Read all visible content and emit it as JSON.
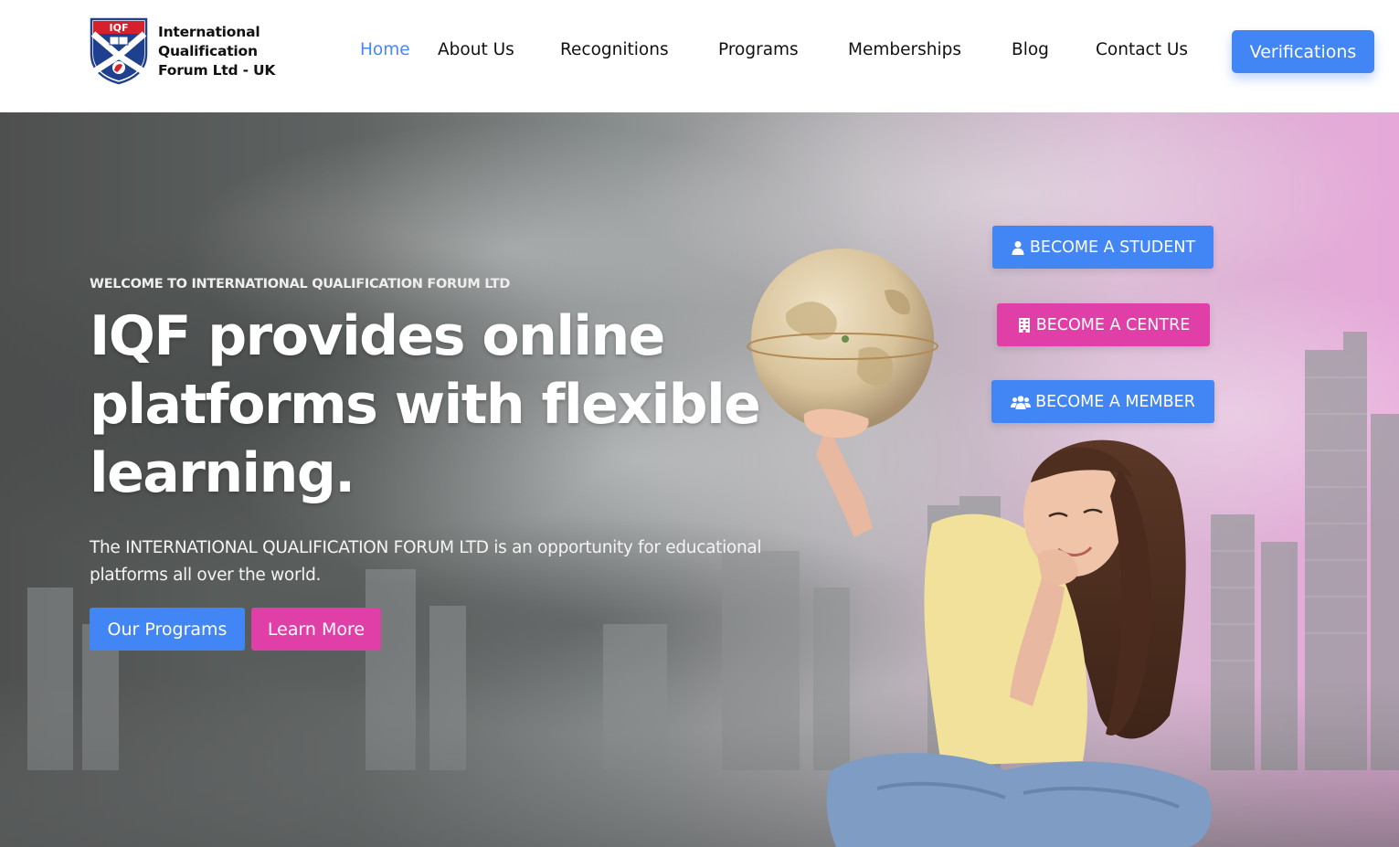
{
  "header": {
    "logo": {
      "shield_text": "IQF",
      "name_line1": "International",
      "name_line2": "Qualification",
      "name_line3": "Forum Ltd - UK"
    },
    "nav": [
      {
        "label": "Home",
        "active": true
      },
      {
        "label": "About Us",
        "active": false
      },
      {
        "label": "Recognitions",
        "active": false
      },
      {
        "label": "Programs",
        "active": false
      },
      {
        "label": "Memberships",
        "active": false
      },
      {
        "label": "Blog",
        "active": false
      },
      {
        "label": "Contact Us",
        "active": false
      }
    ],
    "verify_label": "Verifications"
  },
  "hero": {
    "welcome": "WELCOME TO INTERNATIONAL QUALIFICATION FORUM LTD",
    "headline": "IQF provides online platforms with flexible learning.",
    "description": "The INTERNATIONAL QUALIFICATION FORUM LTD is an opportunity for educational platforms all over the world.",
    "buttons": {
      "programs": "Our Programs",
      "learn_more": "Learn More"
    },
    "cta": {
      "student": {
        "label": "BECOME A STUDENT",
        "icon": "user-icon"
      },
      "centre": {
        "label": "BECOME A CENTRE",
        "icon": "building-icon"
      },
      "member": {
        "label": "BECOME A MEMBER",
        "icon": "users-icon"
      }
    }
  },
  "colors": {
    "primary_blue": "#4285f4",
    "accent_pink": "#e03fa8",
    "nav_active": "#4a86f5",
    "text_dark": "#111111"
  }
}
